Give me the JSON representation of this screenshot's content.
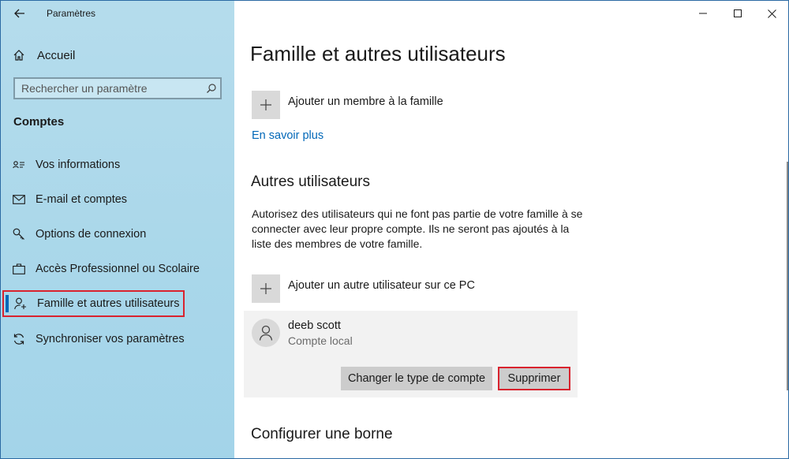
{
  "window": {
    "app_title": "Paramètres",
    "controls": [
      "minimize",
      "maximize",
      "close"
    ]
  },
  "sidebar": {
    "home_label": "Accueil",
    "search_placeholder": "Rechercher un paramètre",
    "section_heading": "Comptes",
    "items": [
      {
        "label": "Vos informations",
        "icon": "contact-card-icon",
        "selected": false
      },
      {
        "label": "E-mail et comptes",
        "icon": "mail-icon",
        "selected": false
      },
      {
        "label": "Options de connexion",
        "icon": "key-icon",
        "selected": false
      },
      {
        "label": "Accès Professionnel ou Scolaire",
        "icon": "briefcase-icon",
        "selected": false
      },
      {
        "label": "Famille et autres utilisateurs",
        "icon": "add-person-icon",
        "selected": true
      },
      {
        "label": "Synchroniser vos paramètres",
        "icon": "sync-icon",
        "selected": false
      }
    ]
  },
  "main": {
    "page_title": "Famille et autres utilisateurs",
    "add_family_label": "Ajouter un membre à la famille",
    "learn_more_link": "En savoir plus",
    "other_users_heading": "Autres utilisateurs",
    "other_users_description": "Autorisez des utilisateurs qui ne font pas partie de votre famille à se connecter avec leur propre compte. Ils ne seront pas ajoutés à la liste des membres de votre famille.",
    "add_other_user_label": "Ajouter un autre utilisateur sur ce PC",
    "user": {
      "name": "deeb scott",
      "account_type": "Compte local",
      "change_type_button": "Changer le type de compte",
      "delete_button": "Supprimer"
    },
    "kiosk_heading": "Configurer une borne"
  },
  "colors": {
    "sidebar_bg": "#a9d7ea",
    "accent": "#0067b8",
    "highlight_box": "#d9232e",
    "button_bg": "#cccccc"
  }
}
